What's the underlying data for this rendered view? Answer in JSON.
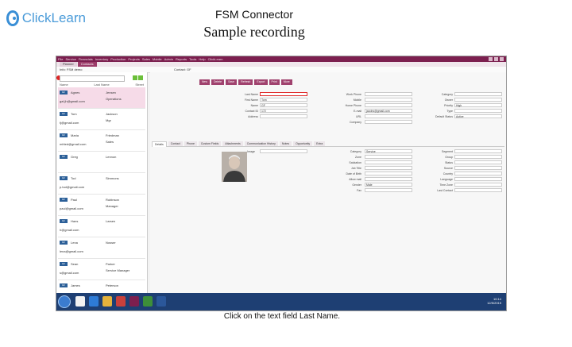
{
  "header": {
    "logo_text": "ClickLearn",
    "title": "FSM Connector",
    "subtitle": "Sample recording"
  },
  "caption": "Click on the text field Last Name.",
  "colors": {
    "accent": "#7c1f4f",
    "button": "#a0426e",
    "highlight": "#e03030",
    "taskbar": "#1e3f73",
    "logo": "#3a8fd6"
  },
  "app": {
    "menu": [
      "File",
      "Service",
      "Financials",
      "Inventory",
      "Production",
      "Projects",
      "Sales",
      "Mobile",
      "Admin",
      "Reports",
      "Tools",
      "Help",
      "ClickLearn"
    ],
    "tabs": [
      "Planner",
      "Contacts"
    ],
    "active_tab": 1,
    "window_title": "Info: FSM demo",
    "record_title": "Contact: GF",
    "list_headers": [
      "Name",
      "Last Name",
      "Street"
    ],
    "people": [
      {
        "badge": "GF",
        "first": "Agnes",
        "last": "Jensen",
        "email": "gal.jh@gmail.com",
        "job": "Operations"
      },
      {
        "badge": "GF",
        "first": "Tom",
        "last": "Jackson",
        "email": "tj@gmail.com",
        "job": "Mgr"
      },
      {
        "badge": "GF",
        "first": "Maria",
        "last": "Friedman",
        "email": "mfried@gmail.com",
        "job": "Sales"
      },
      {
        "badge": "GF",
        "first": "Greg",
        "last": "Lennon",
        "email": "",
        "job": ""
      },
      {
        "badge": "GF",
        "first": "Tod",
        "last": "Simmons",
        "email": "p.tod@gmail.com",
        "job": ""
      },
      {
        "badge": "GF",
        "first": "Paul",
        "last": "Rubinson",
        "email": "paul@gmail.com",
        "job": "Manager"
      },
      {
        "badge": "GF",
        "first": "Hans",
        "last": "Larsen",
        "email": "h@gmail.com",
        "job": ""
      },
      {
        "badge": "GF",
        "first": "Lena",
        "last": "Nosser",
        "email": "lena@gmail.com",
        "job": ""
      },
      {
        "badge": "GF",
        "first": "Sean",
        "last": "Parker",
        "email": "s@gmail.com",
        "job": "Service Manager"
      },
      {
        "badge": "GF",
        "first": "James",
        "last": "Peterson",
        "email": "",
        "job": ""
      }
    ],
    "action_buttons": [
      "New",
      "Delete",
      "Save",
      "Refresh",
      "Export",
      "Print",
      "More"
    ],
    "form_left": [
      {
        "label": "Last Name",
        "value": "",
        "highlight": true
      },
      {
        "label": "First Name",
        "value": "Tom"
      },
      {
        "label": "Name",
        "value": "GF"
      },
      {
        "label": "Contact ID",
        "value": "172"
      },
      {
        "label": "Address",
        "value": ""
      }
    ],
    "form_mid": [
      {
        "label": "Work Phone",
        "value": ""
      },
      {
        "label": "Mobile",
        "value": ""
      },
      {
        "label": "Home Phone",
        "value": ""
      },
      {
        "label": "E-mail",
        "value": "jacobs@gmail.com"
      },
      {
        "label": "URL",
        "value": ""
      },
      {
        "label": "Company",
        "value": ""
      }
    ],
    "form_right": [
      {
        "label": "Category",
        "value": ""
      },
      {
        "label": "Owner",
        "value": ""
      },
      {
        "label": "Priority",
        "value": "High"
      },
      {
        "label": "Type",
        "value": ""
      },
      {
        "label": "Default Status",
        "value": "Active"
      }
    ],
    "form_tabs": [
      "Details",
      "Contact",
      "Phone",
      "Custom Fields",
      "Attachments",
      "Communication History",
      "Notes",
      "Opportunity",
      "Extra"
    ],
    "detail_left": [
      {
        "label": "Image",
        "value": ""
      }
    ],
    "detail_mid": [
      {
        "label": "Category",
        "value": "Service"
      },
      {
        "label": "Zone",
        "value": ""
      },
      {
        "label": "Salutation",
        "value": ""
      },
      {
        "label": "Job Title",
        "value": ""
      },
      {
        "label": "Date of Birth",
        "value": ""
      },
      {
        "label": "Allow mail",
        "value": ""
      },
      {
        "label": "Gender",
        "value": "Male"
      },
      {
        "label": "Fax",
        "value": ""
      }
    ],
    "detail_right": [
      {
        "label": "Segment",
        "value": ""
      },
      {
        "label": "Group",
        "value": ""
      },
      {
        "label": "Status",
        "value": ""
      },
      {
        "label": "Source",
        "value": ""
      },
      {
        "label": "Country",
        "value": ""
      },
      {
        "label": "Language",
        "value": ""
      },
      {
        "label": "Time Zone",
        "value": ""
      },
      {
        "label": "Last Contact",
        "value": ""
      }
    ],
    "clock": {
      "time": "10:14",
      "date": "12/5/2015"
    }
  }
}
